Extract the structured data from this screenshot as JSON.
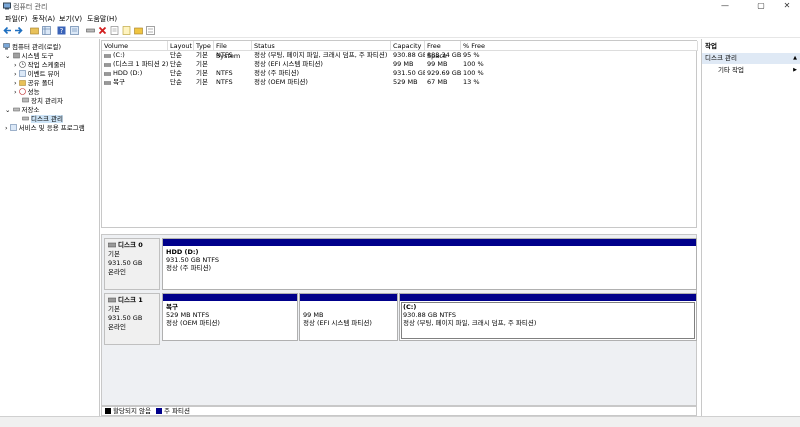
{
  "window": {
    "title": "컴퓨터 관리",
    "minimize": "—",
    "maximize": "▢",
    "close": "✕"
  },
  "menu": [
    "파일(F)",
    "동작(A)",
    "보기(V)",
    "도움말(H)"
  ],
  "tree": {
    "items": [
      {
        "label": "컴퓨터 관리(로컬)"
      },
      {
        "label": "시스템 도구"
      },
      {
        "label": "작업 스케줄러"
      },
      {
        "label": "이벤트 뷰어"
      },
      {
        "label": "공유 폴더"
      },
      {
        "label": "성능"
      },
      {
        "label": "장치 관리자"
      },
      {
        "label": "저장소"
      },
      {
        "label": "디스크 관리"
      },
      {
        "label": "서비스 및 응용 프로그램"
      }
    ]
  },
  "table": {
    "headers": [
      "Volume",
      "Layout",
      "Type",
      "File System",
      "Status",
      "Capacity",
      "Free Space",
      "% Free"
    ],
    "rows": [
      [
        "(C:)",
        "단순",
        "기본",
        "NTFS",
        "정상 (부팅, 페이지 파일, 크래시 덤프, 주 파티션)",
        "930.88 GB",
        "888.34 GB",
        "95 %"
      ],
      [
        "(디스크 1 파티션 2)",
        "단순",
        "기본",
        "",
        "정상 (EFI 시스템 파티션)",
        "99 MB",
        "99 MB",
        "100 %"
      ],
      [
        "HDD (D:)",
        "단순",
        "기본",
        "NTFS",
        "정상 (주 파티션)",
        "931.50 GB",
        "929.69 GB",
        "100 %"
      ],
      [
        "복구",
        "단순",
        "기본",
        "NTFS",
        "정상 (OEM 파티션)",
        "529 MB",
        "67 MB",
        "13 %"
      ]
    ]
  },
  "disks": [
    {
      "name": "디스크 0",
      "type": "기본",
      "size": "931.50 GB",
      "state": "온라인",
      "partitions": [
        {
          "title": "HDD  (D:)",
          "line1": "931.50 GB NTFS",
          "line2": "정상 (주 파티션)"
        }
      ]
    },
    {
      "name": "디스크 1",
      "type": "기본",
      "size": "931.50 GB",
      "state": "온라인",
      "partitions": [
        {
          "title": "복구",
          "line1": "529 MB NTFS",
          "line2": "정상 (OEM 파티션)"
        },
        {
          "title": "",
          "line1": "99 MB",
          "line2": "정상 (EFI 시스템 파티션)"
        },
        {
          "title": "(C:)",
          "line1": "930.88 GB NTFS",
          "line2": "정상 (부팅, 페이지 파일, 크래시 덤프, 주 파티션)"
        }
      ]
    }
  ],
  "legend": {
    "unallocated": "할당되지 않음",
    "primary": "주 파티션",
    "unallocated_color": "#000000",
    "primary_color": "#00008b"
  },
  "actions": {
    "header": "작업",
    "section": "디스크 관리",
    "more": "기타 작업",
    "more_arrow": "▶",
    "collapse_arrow": "▲"
  },
  "colors": {
    "partition_header": "#00008b",
    "selection": "#cde4f7"
  },
  "icons": [
    "back-icon",
    "forward-icon",
    "folder-icon",
    "grid-icon",
    "help-icon",
    "console-icon",
    "network-drive-icon",
    "delete-icon",
    "properties-icon",
    "new-icon",
    "open-icon",
    "tree-icon"
  ]
}
